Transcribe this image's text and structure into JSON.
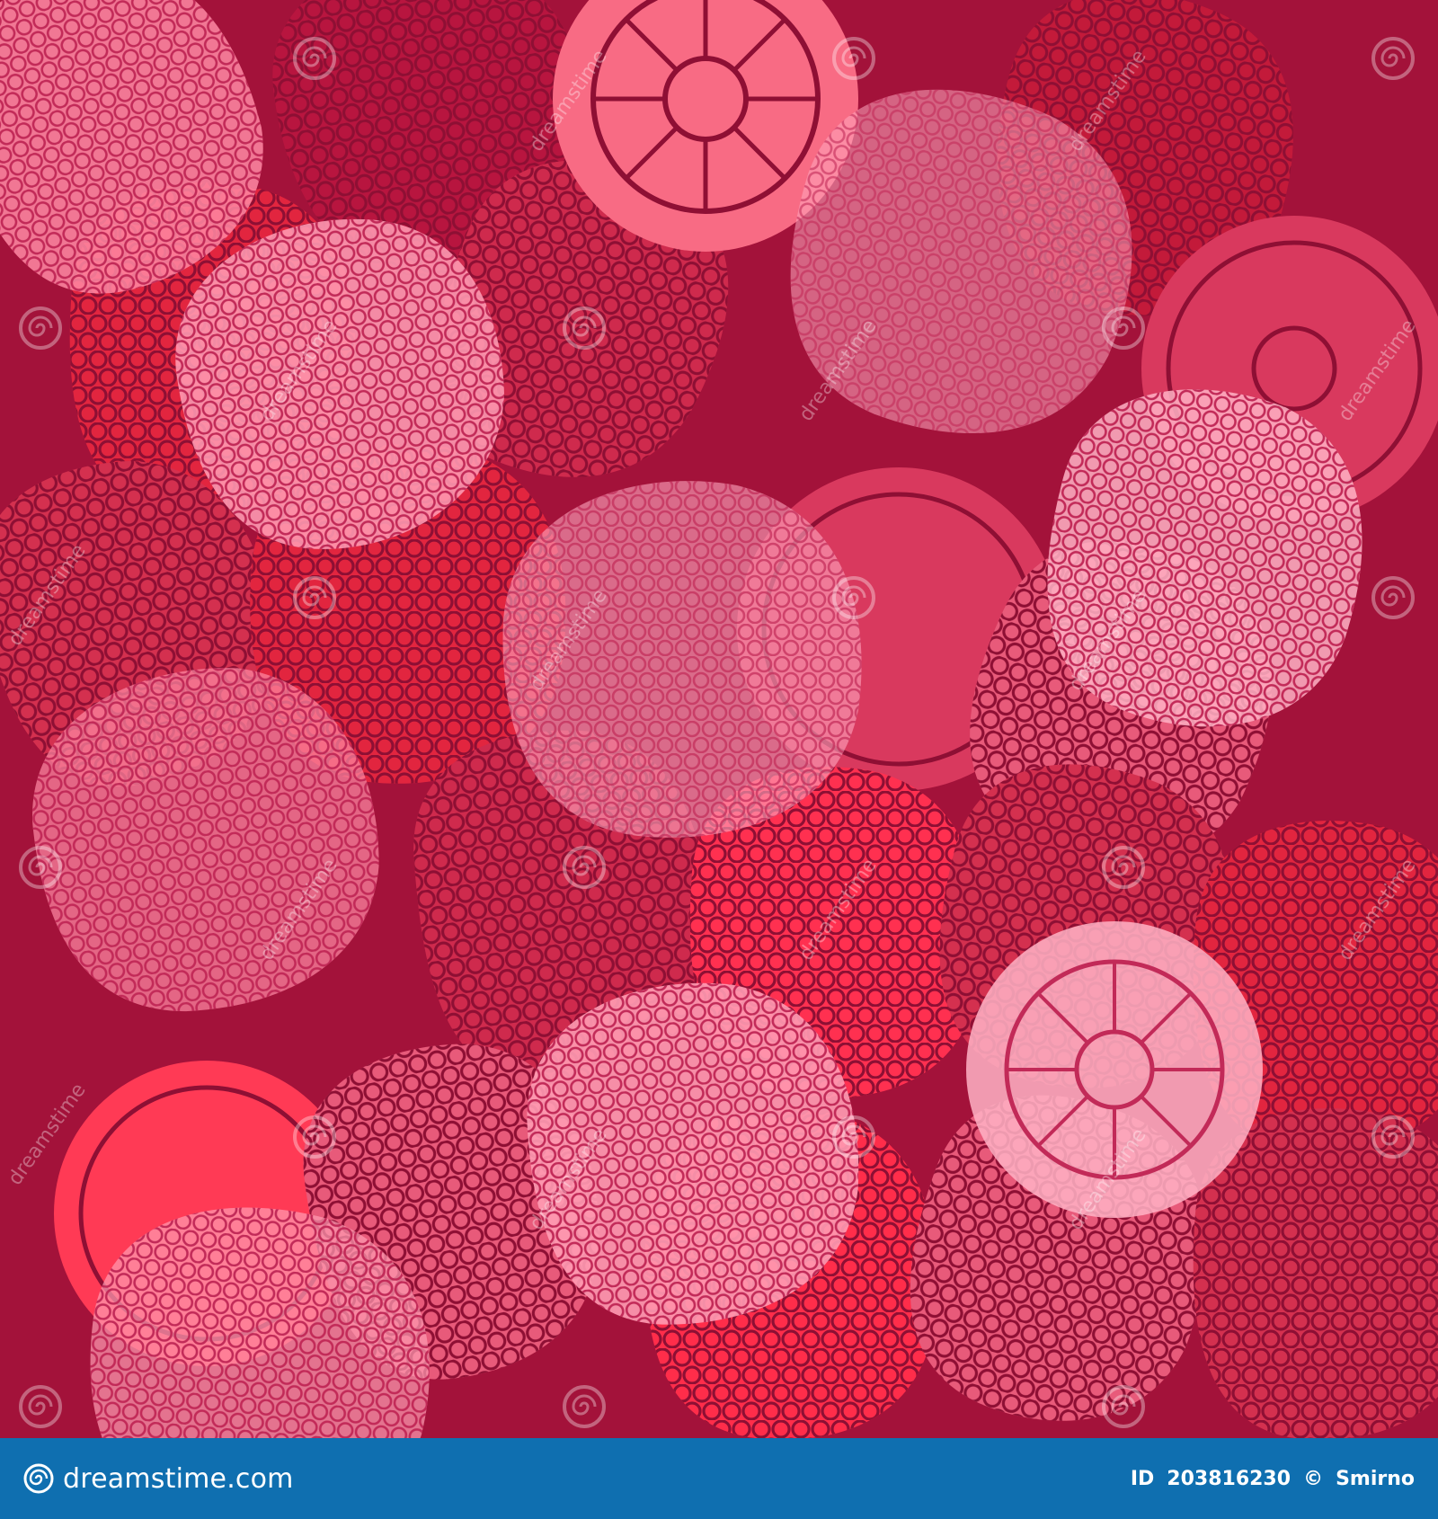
{
  "image": {
    "subject": "seamless pattern of overlapping pink and red raspberries",
    "colors": {
      "background": "#a3123a",
      "berry_deep": "#b8153f",
      "berry_red": "#e2253f",
      "berry_rose": "#d9395e",
      "berry_pink": "#f2607c",
      "berry_light": "#ff9cb4",
      "outline": "#8e0f34",
      "footer_bar": "#0f6fb0"
    }
  },
  "watermark": {
    "text": "dreamstime",
    "icon": "spiral-icon"
  },
  "footer": {
    "brand": "dreamstime.com",
    "id_label": "ID",
    "id_value": "203816230",
    "copyright": "©",
    "author": "Smirno"
  }
}
